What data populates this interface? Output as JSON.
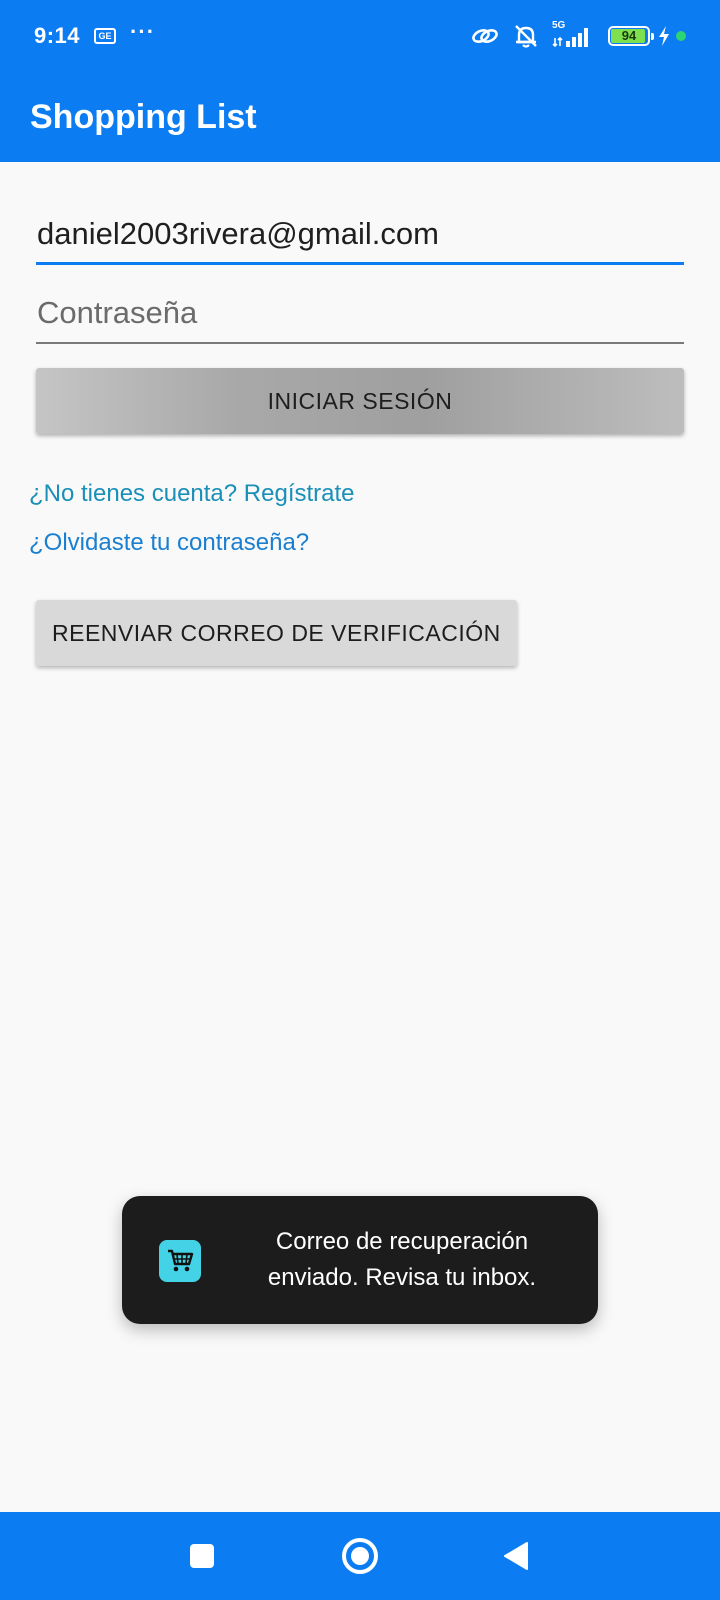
{
  "status_bar": {
    "time": "9:14",
    "ge_label": "GE",
    "more_indicator": "···",
    "network_label": "5G",
    "battery_level": "94",
    "battery_fraction": 0.94,
    "icons": [
      "ge-notification-icon",
      "link-icon",
      "bell-off-icon",
      "signal-icon",
      "battery-icon",
      "charging-icon",
      "privacy-dot-icon"
    ],
    "colors": {
      "battery_fill": "#7ee04f",
      "privacy_dot": "#2ed573"
    }
  },
  "app_bar": {
    "title": "Shopping List",
    "background": "#0c7cf3"
  },
  "form": {
    "email": {
      "value": "daniel2003rivera@gmail.com",
      "placeholder": "",
      "focused": true
    },
    "password": {
      "value": "",
      "placeholder": "Contraseña"
    },
    "login_button": "INICIAR SESIÓN",
    "register_link": "¿No tienes cuenta? Regístrate",
    "forgot_link": "¿Olvidaste tu contraseña?",
    "resend_button": "REENVIAR CORREO DE VERIFICACIÓN"
  },
  "toast": {
    "icon": "shopping-cart-icon",
    "message": "Correo de recuperación enviado. Revisa tu inbox."
  },
  "nav_bar": {
    "buttons": [
      "recents-icon",
      "home-icon",
      "back-icon"
    ]
  }
}
